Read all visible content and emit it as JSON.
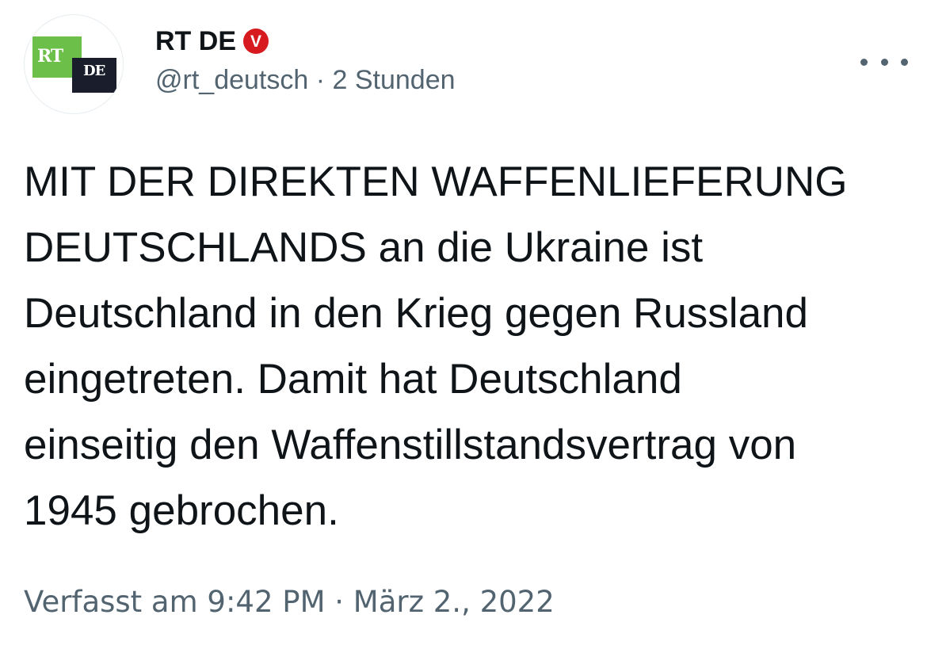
{
  "author": {
    "avatar_logo_primary": "RT",
    "avatar_logo_secondary": "DE",
    "display_name": "RT DE",
    "verified_badge": "V",
    "handle": "@rt_deutsch",
    "separator": " · ",
    "relative_time": "2 Stunden"
  },
  "menu": {
    "icon": "more-horizontal-icon"
  },
  "tweet": {
    "text": "MIT DER DIREKTEN WAFFENLIEFERUNG\nDEUTSCHLANDS an die Ukraine ist\nDeutschland in den Krieg gegen Russland\neingetreten. Damit hat Deutschland\neinseitig den Waffenstillstandsvertrag von\n1945 gebrochen."
  },
  "footer": {
    "posted_label": "Verfasst am 9:42 PM · März 2., 2022"
  },
  "colors": {
    "text": "#0f1419",
    "secondary": "#536471",
    "badge": "#d71920",
    "logo_green": "#6cc04a",
    "logo_dark": "#1a1d2b"
  }
}
